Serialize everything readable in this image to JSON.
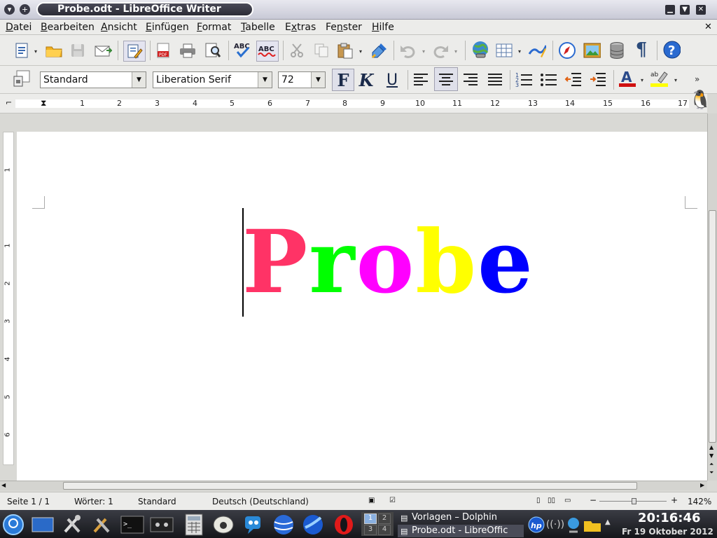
{
  "window": {
    "title": "Probe.odt - LibreOffice Writer"
  },
  "menu": {
    "items": [
      "Datei",
      "Bearbeiten",
      "Ansicht",
      "Einfügen",
      "Format",
      "Tabelle",
      "Extras",
      "Fenster",
      "Hilfe"
    ],
    "accel": [
      "D",
      "B",
      "A",
      "E",
      "F",
      "T",
      "x",
      "n",
      "H"
    ]
  },
  "format_bar": {
    "style": "Standard",
    "font": "Liberation Serif",
    "size": "72",
    "bold_label": "F",
    "italic_label": "K",
    "underline_label": "U"
  },
  "ruler": {
    "numbers": [
      "1",
      "2",
      "3",
      "4",
      "5",
      "6",
      "7",
      "8",
      "9",
      "10",
      "11",
      "12",
      "13",
      "14",
      "15",
      "16",
      "17"
    ],
    "vnumbers": [
      "1",
      "1",
      "2",
      "3",
      "4",
      "5",
      "6"
    ]
  },
  "document": {
    "text": "Probe",
    "letters": [
      {
        "char": "P",
        "color": "#ff3366"
      },
      {
        "char": "r",
        "color": "#00ff00"
      },
      {
        "char": "o",
        "color": "#ff00ff"
      },
      {
        "char": "b",
        "color": "#ffff00"
      },
      {
        "char": "e",
        "color": "#0000ff"
      }
    ]
  },
  "status": {
    "page": "Seite 1 / 1",
    "words": "Wörter: 1",
    "style": "Standard",
    "language": "Deutsch (Deutschland)",
    "zoom": "142%"
  },
  "taskbar": {
    "tasks": [
      "Vorlagen – Dolphin",
      "Probe.odt - LibreOffic"
    ],
    "pager": [
      "1",
      "2",
      "3",
      "4"
    ],
    "time": "20:16:46",
    "date": "Fr 19 Oktober 2012"
  },
  "icons": {
    "toolbar1": [
      "new-document-icon",
      "open-folder-icon",
      "save-icon",
      "email-icon",
      "edit-mode-icon",
      "export-pdf-icon",
      "print-icon",
      "print-preview-icon",
      "spellcheck-icon",
      "autospell-icon",
      "cut-icon",
      "copy-icon",
      "paste-icon",
      "format-paintbrush-icon",
      "undo-icon",
      "redo-icon",
      "hyperlink-icon",
      "table-icon",
      "draw-functions-icon",
      "navigator-icon",
      "gallery-icon",
      "data-sources-icon",
      "formatting-marks-icon",
      "help-icon"
    ]
  }
}
